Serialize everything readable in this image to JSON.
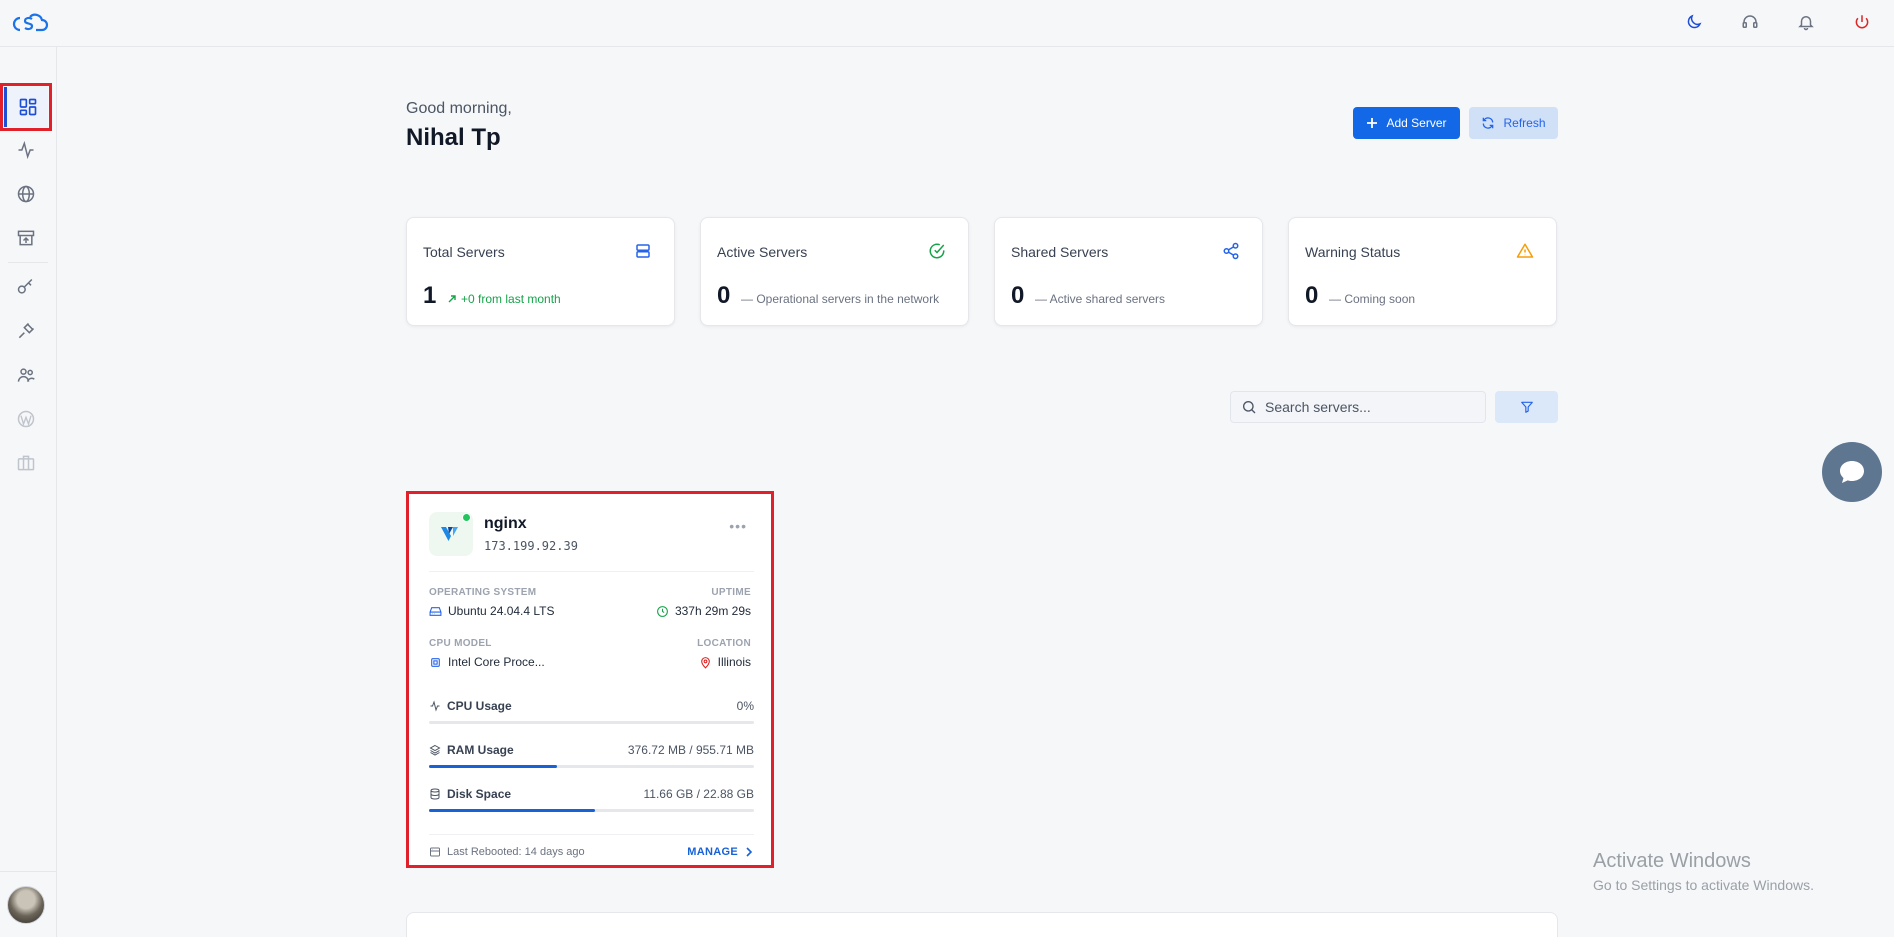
{
  "header": {
    "logo_text": "cS"
  },
  "greeting": {
    "subtitle": "Good morning,",
    "name": "Nihal Tp"
  },
  "actions": {
    "add_label": "Add Server",
    "refresh_label": "Refresh"
  },
  "stats": [
    {
      "title": "Total Servers",
      "value": "1",
      "note": "+0 from last month"
    },
    {
      "title": "Active Servers",
      "value": "0",
      "note": "— Operational servers in the network"
    },
    {
      "title": "Shared Servers",
      "value": "0",
      "note": "— Active shared servers"
    },
    {
      "title": "Warning Status",
      "value": "0",
      "note": "— Coming soon"
    }
  ],
  "search": {
    "placeholder": "Search servers..."
  },
  "server": {
    "name": "nginx",
    "ip": "173.199.92.39",
    "more": "•••",
    "os_label": "OPERATING SYSTEM",
    "os_value": "Ubuntu 24.04.4 LTS",
    "uptime_label": "UPTIME",
    "uptime_value": "337h 29m 29s",
    "cpu_model_label": "CPU MODEL",
    "cpu_model_value": "Intel Core Proce...",
    "location_label": "LOCATION",
    "location_value": "Illinois",
    "cpu_usage_label": "CPU Usage",
    "cpu_usage_value": "0%",
    "cpu_usage_fraction": 0,
    "ram_label": "RAM Usage",
    "ram_value": "376.72 MB / 955.71 MB",
    "ram_fraction": 0.394,
    "disk_label": "Disk Space",
    "disk_value": "11.66 GB / 22.88 GB",
    "disk_fraction": 0.51,
    "last_rebooted": "Last Rebooted: 14 days ago",
    "manage_label": "MANAGE"
  },
  "watermark": {
    "line1": "Activate Windows",
    "line2": "Go to Settings to activate Windows."
  },
  "colors": {
    "primary": "#1368e8",
    "success": "#22c55e",
    "warning": "#f59e0b",
    "danger": "#e0202a"
  }
}
